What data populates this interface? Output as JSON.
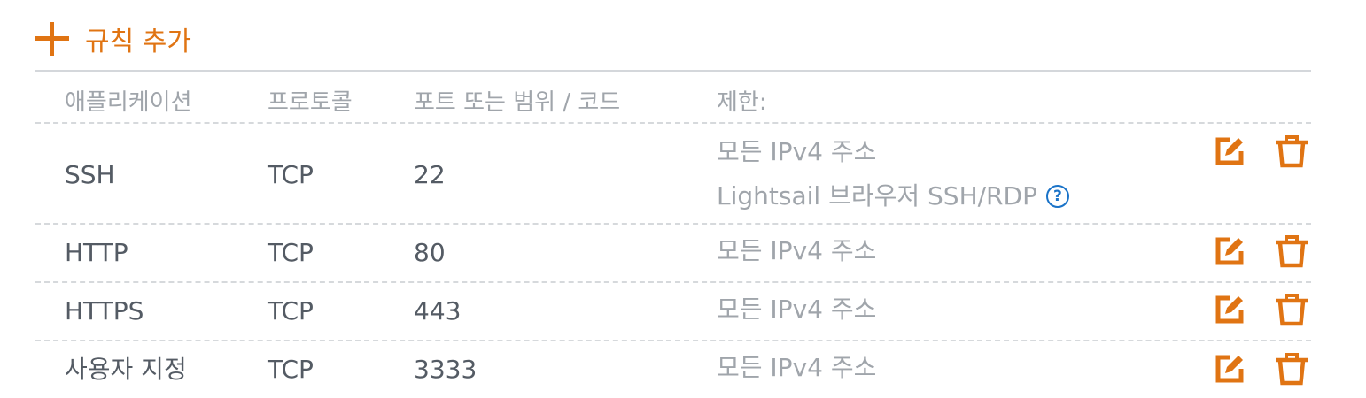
{
  "toolbar": {
    "add_rule_label": "규칙 추가"
  },
  "table": {
    "headers": {
      "application": "애플리케이션",
      "protocol": "프로토콜",
      "port": "포트 또는 범위 / 코드",
      "restriction": "제한:"
    },
    "rows": [
      {
        "application": "SSH",
        "protocol": "TCP",
        "port": "22",
        "restriction": "모든 IPv4 주소",
        "restriction_extra": "Lightsail 브라우저 SSH/RDP",
        "help_icon": "?"
      },
      {
        "application": "HTTP",
        "protocol": "TCP",
        "port": "80",
        "restriction": "모든 IPv4 주소"
      },
      {
        "application": "HTTPS",
        "protocol": "TCP",
        "port": "443",
        "restriction": "모든 IPv4 주소"
      },
      {
        "application": "사용자 지정",
        "protocol": "TCP",
        "port": "3333",
        "restriction": "모든 IPv4 주소"
      }
    ]
  },
  "icons": {
    "add": "plus-icon",
    "edit": "edit-icon",
    "delete": "trash-icon",
    "help": "help-circle-icon"
  },
  "colors": {
    "accent": "#e07413",
    "help": "#1a73c8",
    "text": "#545b64",
    "muted": "#a0a5ab",
    "divider": "#d6d9dc"
  }
}
